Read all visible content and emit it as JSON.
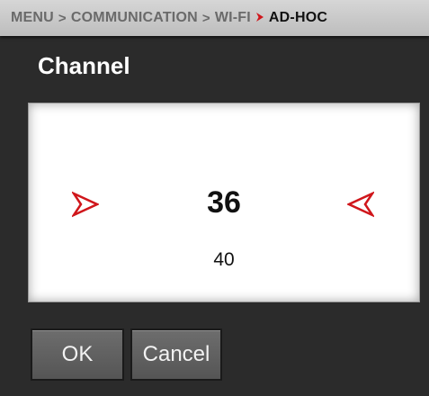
{
  "breadcrumb": {
    "items": [
      "MENU",
      "COMMUNICATION",
      "WI-FI",
      "AD-HOC"
    ],
    "separator": ">",
    "active_separator_color": "#d0161b"
  },
  "page": {
    "title": "Channel"
  },
  "picker": {
    "selected_value": "36",
    "next_value": "40",
    "arrow_color": "#d0161b"
  },
  "buttons": {
    "ok_label": "OK",
    "cancel_label": "Cancel"
  }
}
